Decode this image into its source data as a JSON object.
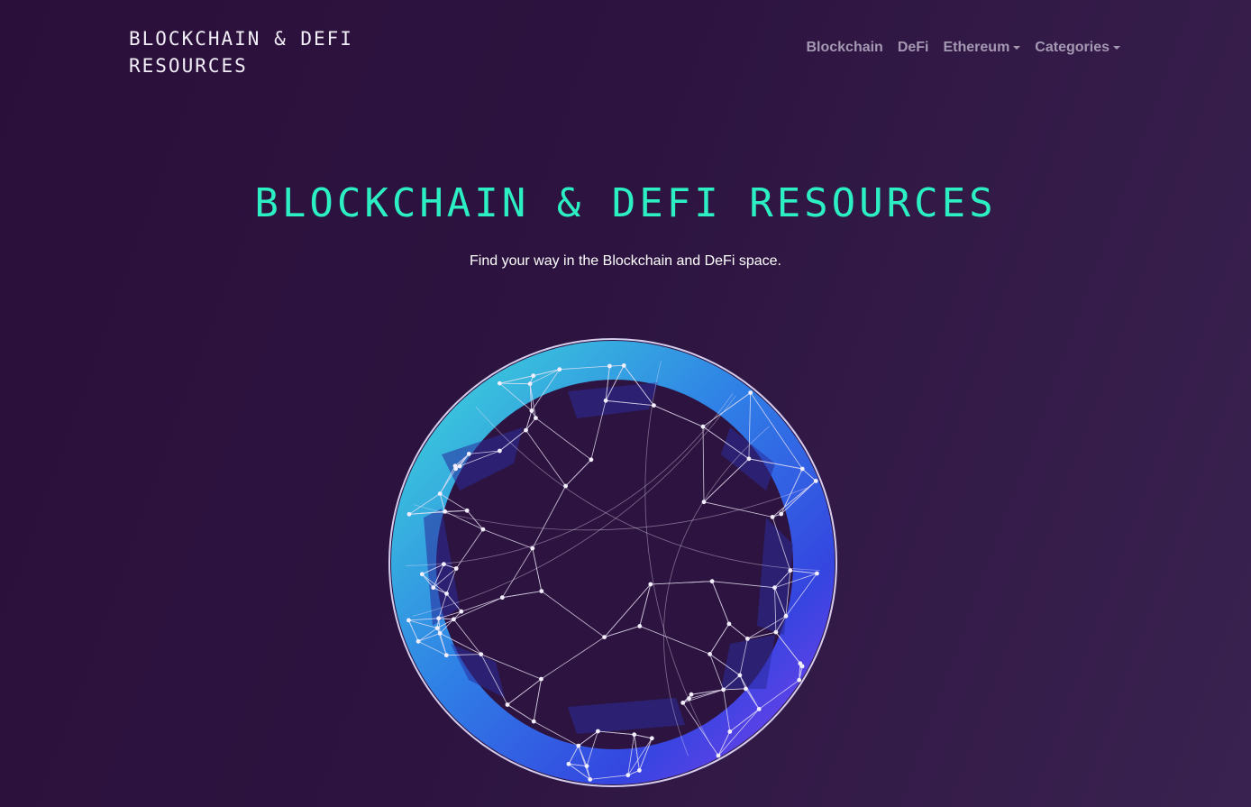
{
  "brand": {
    "line1": "BLOCKCHAIN & DEFI",
    "line2": "RESOURCES"
  },
  "nav": {
    "items": [
      {
        "label": "Blockchain",
        "dropdown": false
      },
      {
        "label": "DeFi",
        "dropdown": false
      },
      {
        "label": "Ethereum",
        "dropdown": true
      },
      {
        "label": "Categories",
        "dropdown": true
      }
    ]
  },
  "hero": {
    "title": "BLOCKCHAIN & DEFI RESOURCES",
    "subtitle": "Find your way in the Blockchain and DeFi space."
  },
  "colors": {
    "background": "#2d1440",
    "accent": "#2cf0c4",
    "nav_text": "#a498b3",
    "globe_cyan": "#3ee0d8",
    "globe_blue": "#3545e0",
    "globe_violet": "#8a3cf0"
  },
  "illustration": {
    "icon": "wireframe-globe-icon"
  }
}
